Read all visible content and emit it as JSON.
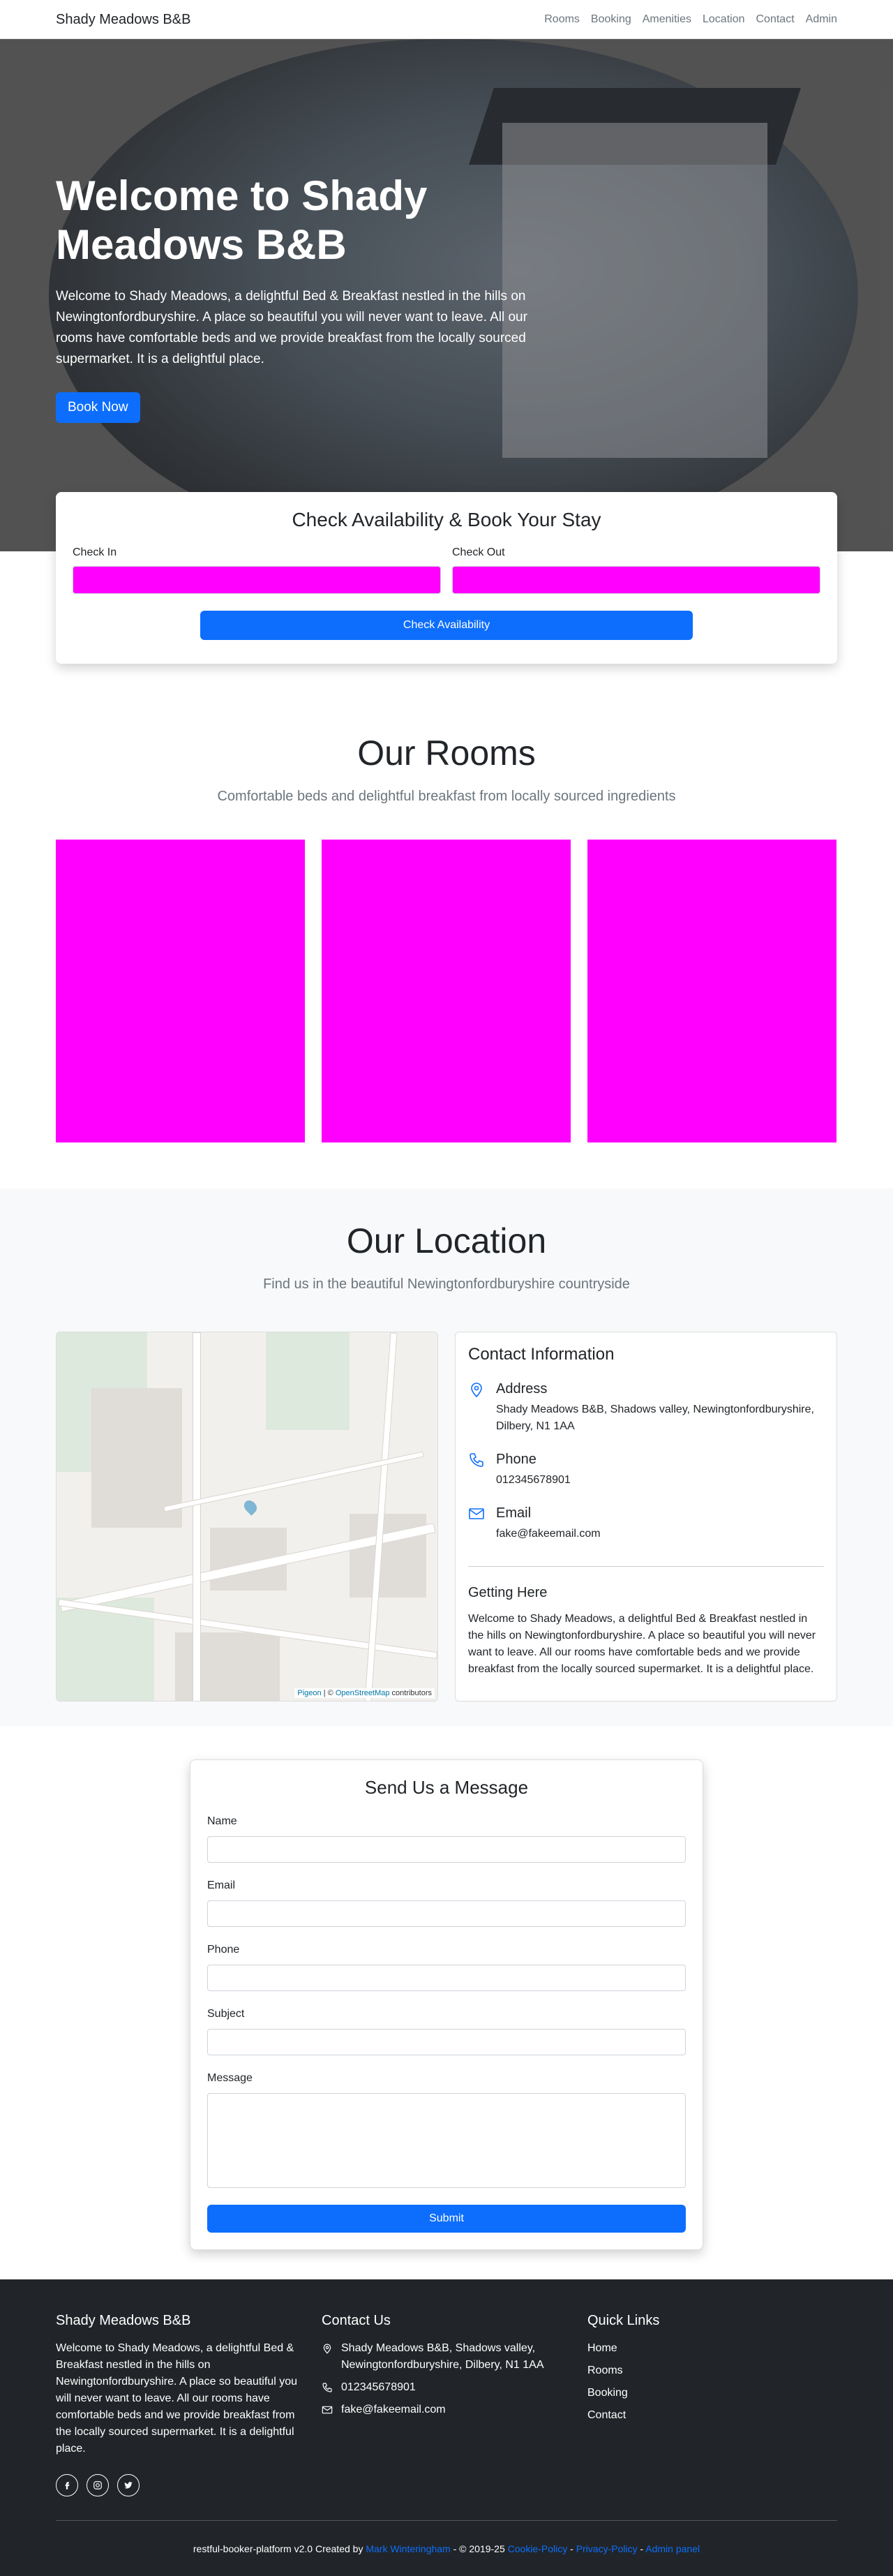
{
  "nav": {
    "brand": "Shady Meadows B&B",
    "links": [
      "Rooms",
      "Booking",
      "Amenities",
      "Location",
      "Contact",
      "Admin"
    ]
  },
  "hero": {
    "title": "Welcome to Shady Meadows B&B",
    "description": "Welcome to Shady Meadows, a delightful Bed & Breakfast nestled in the hills on Newingtonfordburyshire. A place so beautiful you will never want to leave. All our rooms have comfortable beds and we provide breakfast from the locally sourced supermarket. It is a delightful place.",
    "cta": "Book Now"
  },
  "booking": {
    "title": "Check Availability & Book Your Stay",
    "check_in_label": "Check In",
    "check_out_label": "Check Out",
    "button": "Check Availability"
  },
  "rooms": {
    "title": "Our Rooms",
    "subtitle": "Comfortable beds and delightful breakfast from locally sourced ingredients"
  },
  "location": {
    "title": "Our Location",
    "subtitle": "Find us in the beautiful Newingtonfordburyshire countryside",
    "map_attribution": {
      "leaflet": "Pigeon",
      "sep": " | © ",
      "osm": "OpenStreetMap",
      "suffix": " contributors"
    },
    "contact": {
      "title": "Contact Information",
      "address_label": "Address",
      "address": "Shady Meadows B&B, Shadows valley, Newingtonfordburyshire, Dilbery, N1 1AA",
      "phone_label": "Phone",
      "phone": "012345678901",
      "email_label": "Email",
      "email": "fake@fakeemail.com",
      "getting_here_title": "Getting Here",
      "getting_here": "Welcome to Shady Meadows, a delightful Bed & Breakfast nestled in the hills on Newingtonfordburyshire. A place so beautiful you will never want to leave. All our rooms have comfortable beds and we provide breakfast from the locally sourced supermarket. It is a delightful place."
    }
  },
  "message": {
    "title": "Send Us a Message",
    "name_label": "Name",
    "email_label": "Email",
    "phone_label": "Phone",
    "subject_label": "Subject",
    "message_label": "Message",
    "submit": "Submit"
  },
  "footer": {
    "brand": "Shady Meadows B&B",
    "description": "Welcome to Shady Meadows, a delightful Bed & Breakfast nestled in the hills on Newingtonfordburyshire. A place so beautiful you will never want to leave. All our rooms have comfortable beds and we provide breakfast from the locally sourced supermarket. It is a delightful place.",
    "contact_title": "Contact Us",
    "address": "Shady Meadows B&B, Shadows valley, Newingtonfordburyshire, Dilbery, N1 1AA",
    "phone": "012345678901",
    "email": "fake@fakeemail.com",
    "links_title": "Quick Links",
    "links": [
      "Home",
      "Rooms",
      "Booking",
      "Contact"
    ],
    "bottom": {
      "prefix": "restful-booker-platform v2.0 Created by ",
      "author": "Mark Winteringham",
      "mid": " - © 2019-25 ",
      "cookie": "Cookie-Policy",
      "sep1": " - ",
      "privacy": "Privacy-Policy",
      "sep2": " - ",
      "admin": "Admin panel"
    }
  },
  "colors": {
    "accent": "#0d6efd",
    "placeholder": "#ff00ff",
    "footer": "#212529"
  }
}
